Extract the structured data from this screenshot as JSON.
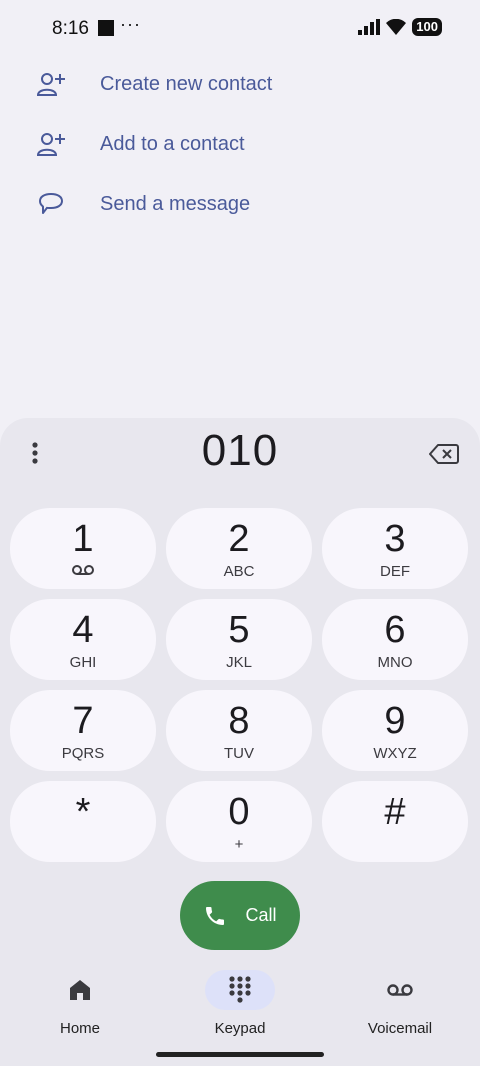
{
  "status_bar": {
    "time": "8:16",
    "dots": "···",
    "battery": "100"
  },
  "actions": [
    {
      "label": "Create new contact",
      "icon": "person-add-icon"
    },
    {
      "label": "Add to a contact",
      "icon": "person-add-icon"
    },
    {
      "label": "Send a message",
      "icon": "message-icon"
    }
  ],
  "dialer": {
    "number": "010",
    "keys": [
      {
        "digit": "1",
        "letters": "",
        "icon": "voicemail-icon"
      },
      {
        "digit": "2",
        "letters": "ABC"
      },
      {
        "digit": "3",
        "letters": "DEF"
      },
      {
        "digit": "4",
        "letters": "GHI"
      },
      {
        "digit": "5",
        "letters": "JKL"
      },
      {
        "digit": "6",
        "letters": "MNO"
      },
      {
        "digit": "7",
        "letters": "PQRS"
      },
      {
        "digit": "8",
        "letters": "TUV"
      },
      {
        "digit": "9",
        "letters": "WXYZ"
      },
      {
        "digit": "*",
        "letters": ""
      },
      {
        "digit": "0",
        "letters": "+"
      },
      {
        "digit": "#",
        "letters": ""
      }
    ],
    "call_label": "Call"
  },
  "nav": {
    "home": "Home",
    "keypad": "Keypad",
    "voicemail": "Voicemail"
  },
  "colors": {
    "accent": "#4a5a9a",
    "call_green": "#3f8c4c",
    "nav_active_bg": "#dde1f9"
  }
}
